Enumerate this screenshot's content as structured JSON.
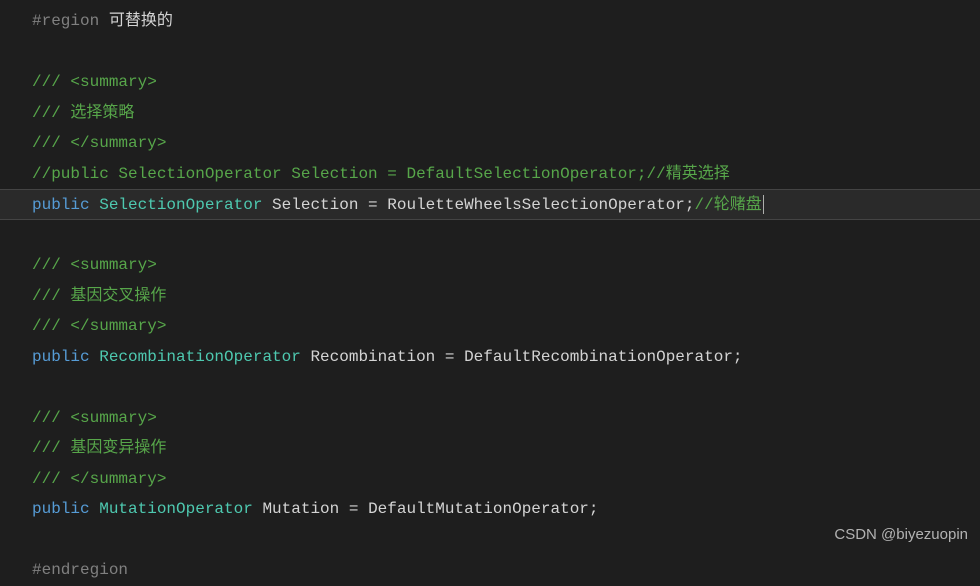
{
  "lines": {
    "l1_region": "#region",
    "l1_text": " 可替换的",
    "l3": "/// <summary>",
    "l4": "/// 选择策略",
    "l5": "/// </summary>",
    "l6": "//public SelectionOperator Selection = DefaultSelectionOperator;//精英选择",
    "l7_public": "public",
    "l7_type": " SelectionOperator",
    "l7_mid": " Selection = RouletteWheelsSelectionOperator;",
    "l7_comment": "//轮赌盘",
    "l9": "/// <summary>",
    "l10": "/// 基因交叉操作",
    "l11": "/// </summary>",
    "l12_public": "public",
    "l12_type": " RecombinationOperator",
    "l12_rest": " Recombination = DefaultRecombinationOperator;",
    "l14": "/// <summary>",
    "l15": "/// 基因变异操作",
    "l16": "/// </summary>",
    "l17_public": "public",
    "l17_type": " MutationOperator",
    "l17_rest": " Mutation = DefaultMutationOperator;",
    "l19": "#endregion"
  },
  "watermark": "CSDN @biyezuopin"
}
